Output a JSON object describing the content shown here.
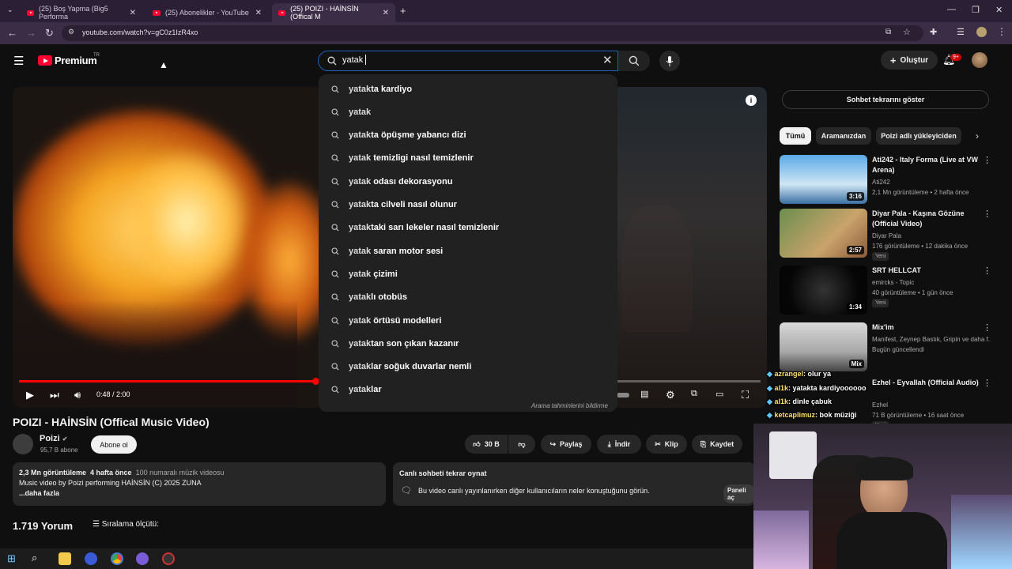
{
  "browser": {
    "tabs": [
      {
        "title": "(25) Boş Yapma (Big5 Performa"
      },
      {
        "title": "(25) Abonelikler - YouTube"
      },
      {
        "title": "(25) POIZI - HAİNSİN (Offical M"
      }
    ],
    "url": "youtube.com/watch?v=gC0z1IzR4xo"
  },
  "masthead": {
    "logo": "Premium",
    "logo_country": "TR",
    "search_query": "yatak",
    "create_label": "Oluştur",
    "notif_count": "9+"
  },
  "suggestions": {
    "items": [
      {
        "prefix": "yatak",
        "suffix": "ta kardiyo"
      },
      {
        "prefix": "yatak",
        "suffix": ""
      },
      {
        "prefix": "yatak",
        "suffix": "ta öpüşme yabancı dizi"
      },
      {
        "prefix": "yatak",
        "suffix": " temizligi nasıl temizlenir"
      },
      {
        "prefix": "yatak",
        "suffix": " odası dekorasyonu"
      },
      {
        "prefix": "yatak",
        "suffix": "ta cilveli nasıl olunur"
      },
      {
        "prefix": "yatak",
        "suffix": "taki sarı lekeler nasıl temizlenir"
      },
      {
        "prefix": "yatak",
        "suffix": " saran motor sesi"
      },
      {
        "prefix": "yatak",
        "suffix": " çizimi"
      },
      {
        "prefix": "yatak",
        "suffix": "lı otobüs"
      },
      {
        "prefix": "yatak",
        "suffix": " örtüsü modelleri"
      },
      {
        "prefix": "yatak",
        "suffix": "tan son çıkan kazanır"
      },
      {
        "prefix": "yatak",
        "suffix": "lar soğuk duvarlar nemli"
      },
      {
        "prefix": "yatak",
        "suffix": "lar"
      }
    ],
    "report_label": "Arama tahminlerini bildirme"
  },
  "player": {
    "time": "0:48 / 2:00",
    "progress": 0.4
  },
  "video": {
    "title": "POIZI - HAİNSİN (Offical Music Video)",
    "channel": "Poizi",
    "subscribers": "95,7 B abone",
    "subscribe_label": "Abone ol",
    "likes": "30 B",
    "share_label": "Paylaş",
    "download_label": "İndir",
    "clip_label": "Klip",
    "save_label": "Kaydet"
  },
  "description": {
    "views": "2,3 Mn görüntüleme",
    "age": "4 hafta önce",
    "tag": "100 numaralı müzik videosu",
    "text": "Music video by Poizi performing HAİNSİN (C) 2025 ZUNA",
    "more": "...daha fazla"
  },
  "replay": {
    "title": "Canlı sohbeti tekrar oynat",
    "text": "Bu video canlı yayınlanırken diğer kullanıcıların neler konuştuğunu görün.",
    "panel_label": "Paneli aç"
  },
  "comments": {
    "count": "1.719 Yorum",
    "sort_label": "Sıralama ölçütü:"
  },
  "sidebar": {
    "chat_button": "Sohbet tekrarını göster",
    "chips": [
      "Tümü",
      "Aramanızdan",
      "Poizi adlı yükleyiciden"
    ],
    "recommendations": [
      {
        "title": "Ati242 - Italy Forma (Live at VW Arena)",
        "channel": "Ati242",
        "meta": "2,1 Mn görüntüleme • 2 hafta önce",
        "duration": "3:16",
        "badge": ""
      },
      {
        "title": "Diyar Pala - Kaşına Gözüne (Official Video)",
        "channel": "Diyar Pala",
        "meta": "176 görüntüleme • 12 dakika önce",
        "duration": "2:57",
        "badge": "Yeni"
      },
      {
        "title": "SRT HELLCAT",
        "channel": "emircks - Topic",
        "meta": "40 görüntüleme • 1 gün önce",
        "duration": "1:34",
        "badge": "Yeni"
      },
      {
        "title": "Mix'im",
        "channel": "Manifest, Zeynep Bastık, Gripin ve daha f...",
        "meta": "Bugün güncellendi",
        "duration": "Mix",
        "badge": ""
      },
      {
        "title": "Ezhel - Eyvallah (Official Audio)",
        "channel": "Ezhel",
        "meta": "71 B görüntüleme • 16 saat önce",
        "duration": "",
        "badge": "Yeni"
      }
    ]
  },
  "chat_overlay": [
    {
      "user": "azrangel",
      "text": ": olur ya"
    },
    {
      "user": "al1k",
      "text": ": yatakta kardiyoooooo"
    },
    {
      "user": "al1k",
      "text": ": dinle çabuk"
    },
    {
      "user": "ketcaplimuz",
      "text": ": bok müziği"
    }
  ]
}
